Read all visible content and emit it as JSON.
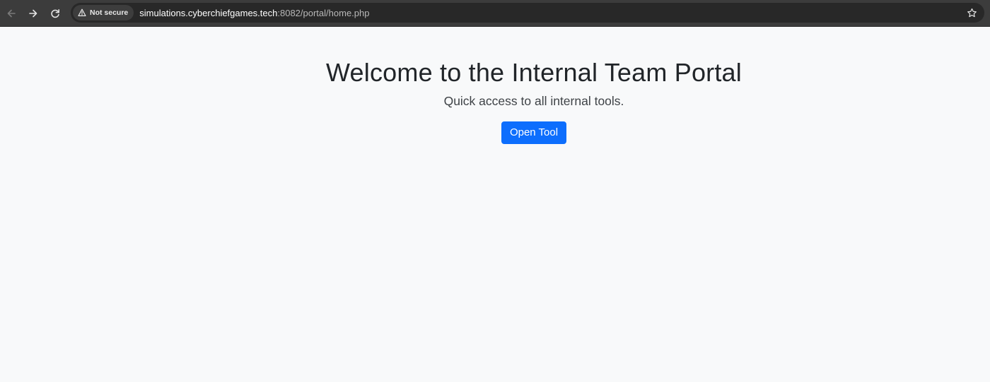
{
  "browser": {
    "security_label": "Not secure",
    "url_host": "simulations.cyberchiefgames.tech",
    "url_rest": ":8082/portal/home.php",
    "icons": [
      "back-arrow-icon",
      "forward-arrow-icon",
      "reload-icon",
      "warning-triangle-icon",
      "star-icon"
    ]
  },
  "page": {
    "title": "Welcome to the Internal Team Portal",
    "subtitle": "Quick access to all internal tools.",
    "button_label": "Open Tool"
  },
  "colors": {
    "page_background": "#f8f9fa",
    "button_primary": "#0d6efd",
    "browser_chrome": "#3c3c3c"
  }
}
